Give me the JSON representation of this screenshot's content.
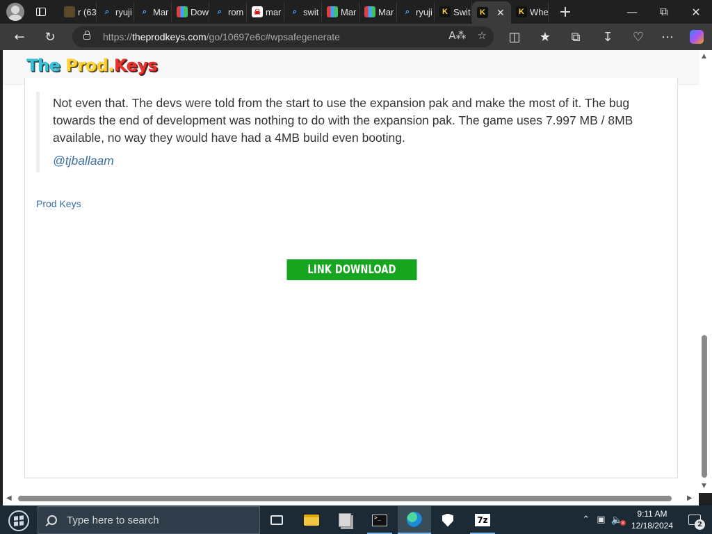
{
  "browser": {
    "tabs": [
      {
        "icon": "folder-icon",
        "title": "r (63"
      },
      {
        "icon": "search-icon",
        "title": "ryuji"
      },
      {
        "icon": "search-icon",
        "title": "Mar"
      },
      {
        "icon": "chart-icon",
        "title": "Dow"
      },
      {
        "icon": "search-icon",
        "title": "rom"
      },
      {
        "icon": "ghost-icon",
        "title": "mar"
      },
      {
        "icon": "search-icon",
        "title": "swit"
      },
      {
        "icon": "chart-icon",
        "title": "Mar"
      },
      {
        "icon": "chart-icon",
        "title": "Mar"
      },
      {
        "icon": "search-icon",
        "title": "ryuji"
      },
      {
        "icon": "k-icon",
        "title": "Swit"
      },
      {
        "icon": "k-icon",
        "title": "",
        "active": true
      },
      {
        "icon": "k-icon",
        "title": "Whe"
      }
    ],
    "url_prefix": "https://",
    "url_domain": "theprodkeys.com",
    "url_path": "/go/10697e6c#wpsafegenerate"
  },
  "page": {
    "logo": {
      "part1": "The ",
      "part2": "Prod.",
      "part3": "Keys"
    },
    "quote_text": "Not even that. The devs were told from the start to use the expansion pak and make the most of it. The bug towards the end of development was nothing to do with the expansion pak. The game uses 7.997 MB / 8MB available, no way they would have had a 4MB build even booting.",
    "quote_author": "@tjballaam",
    "prod_keys_link": "Prod Keys",
    "download_button": "LINK DOWNLOAD"
  },
  "taskbar": {
    "search_placeholder": "Type here to search",
    "time": "9:11 AM",
    "date": "12/18/2024",
    "notification_count": "2",
    "apps": [
      "task-view-icon",
      "file-explorer-icon",
      "files-icon",
      "terminal-icon",
      "edge-icon",
      "security-shield-icon",
      "7zip-icon"
    ],
    "sevenzip_label": "7z"
  },
  "colors": {
    "download_button": "#17a51f",
    "link": "#3a6ea5",
    "taskbar": "#1c2a36"
  }
}
